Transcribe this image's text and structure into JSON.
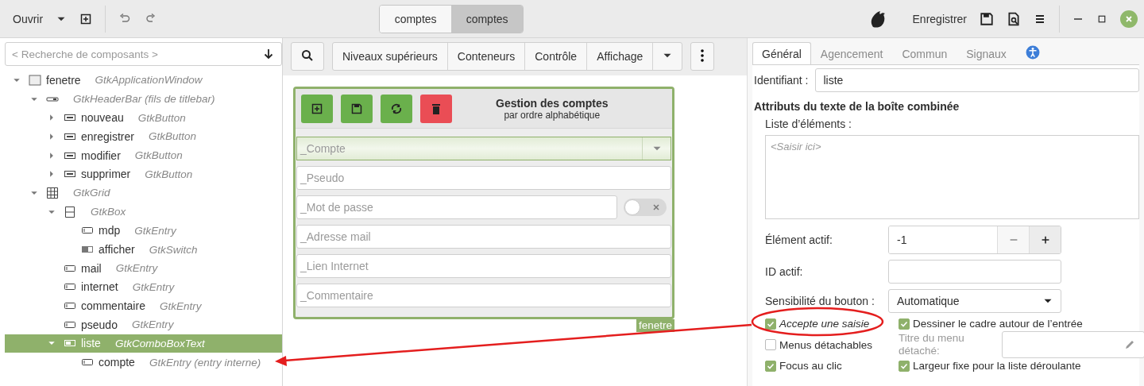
{
  "header": {
    "open_button": "Ouvrir",
    "switcher": [
      {
        "label": "comptes",
        "selected": false
      },
      {
        "label": "comptes",
        "selected": true
      }
    ],
    "save_button": "Enregistrer"
  },
  "search": {
    "placeholder": "< Recherche de composants >"
  },
  "tree": [
    {
      "kind": "window",
      "name": "fenetre",
      "type": "GtkApplicationWindow",
      "expanded": true,
      "selected": false,
      "children": [
        {
          "kind": "headerbar",
          "type": "GtkHeaderBar",
          "note": "(fils de titlebar)",
          "expanded": true,
          "selected": false,
          "children": [
            {
              "kind": "button",
              "name": "nouveau",
              "type": "GtkButton",
              "expanded": false,
              "selected": false
            },
            {
              "kind": "button",
              "name": "enregistrer",
              "type": "GtkButton",
              "expanded": false,
              "selected": false
            },
            {
              "kind": "button",
              "name": "modifier",
              "type": "GtkButton",
              "expanded": false,
              "selected": false
            },
            {
              "kind": "button",
              "name": "supprimer",
              "type": "GtkButton",
              "expanded": false,
              "selected": false
            }
          ]
        },
        {
          "kind": "grid",
          "type": "GtkGrid",
          "expanded": true,
          "selected": false,
          "children": [
            {
              "kind": "box",
              "type": "GtkBox",
              "expanded": true,
              "selected": false,
              "children": [
                {
                  "kind": "entry",
                  "name": "mdp",
                  "type": "GtkEntry",
                  "selected": false
                },
                {
                  "kind": "switch",
                  "name": "afficher",
                  "type": "GtkSwitch",
                  "selected": false
                }
              ]
            },
            {
              "kind": "entry",
              "name": "mail",
              "type": "GtkEntry",
              "selected": false
            },
            {
              "kind": "entry",
              "name": "internet",
              "type": "GtkEntry",
              "selected": false
            },
            {
              "kind": "entry",
              "name": "commentaire",
              "type": "GtkEntry",
              "selected": false
            },
            {
              "kind": "entry",
              "name": "pseudo",
              "type": "GtkEntry",
              "selected": false
            },
            {
              "kind": "combo",
              "name": "liste",
              "type": "GtkComboBoxText",
              "expanded": true,
              "selected": true,
              "children": [
                {
                  "kind": "entry",
                  "name": "compte",
                  "type": "GtkEntry",
                  "note": "(entry interne)",
                  "selected": false
                }
              ]
            }
          ]
        }
      ]
    }
  ],
  "palette": {
    "groups": [
      "Niveaux supérieurs",
      "Conteneurs",
      "Contrôle",
      "Affichage"
    ]
  },
  "preview": {
    "title": "Gestion des comptes",
    "subtitle": "par ordre alphabétique",
    "toolbar": [
      {
        "kind": "new"
      },
      {
        "kind": "save"
      },
      {
        "kind": "refresh"
      },
      {
        "kind": "delete"
      }
    ],
    "combo": {
      "placeholder": "_Compte"
    },
    "entries": [
      {
        "kind": "entry",
        "placeholder": "_Pseudo"
      },
      {
        "kind": "password",
        "placeholder": "_Mot de passe",
        "switch_on": false
      },
      {
        "kind": "entry",
        "placeholder": "_Adresse mail"
      },
      {
        "kind": "entry",
        "placeholder": "_Lien Internet"
      },
      {
        "kind": "entry",
        "placeholder": "_Commentaire"
      }
    ],
    "window_label": "fenetre"
  },
  "inspector": {
    "tabs": [
      {
        "label": "Général",
        "selected": true
      },
      {
        "label": "Agencement",
        "selected": false
      },
      {
        "label": "Commun",
        "selected": false
      },
      {
        "label": "Signaux",
        "selected": false
      }
    ],
    "accessibility_tab": {
      "selected": false
    },
    "id_label": "Identifiant :",
    "id_value": "liste",
    "section": "Attributs du texte de la boîte combinée",
    "items_label": "Liste d’éléments :",
    "items_placeholder": "<Saisir ici>",
    "active_label": "Élément actif:",
    "active_value": "-1",
    "active_id_label": "ID actif:",
    "sensitivity_label": "Sensibilité du bouton :",
    "sensitivity_value": "Automatique",
    "checks": [
      {
        "label": "Accepte une saisie",
        "checked": true,
        "italic": true
      },
      {
        "label": "Dessiner le cadre autour de l’entrée",
        "checked": true,
        "italic": false
      },
      {
        "label": "Menus détachables",
        "checked": false,
        "italic": false
      },
      {
        "label": "Focus au clic",
        "checked": true,
        "italic": false
      },
      {
        "label": "Largeur fixe pour la liste déroulante",
        "checked": true,
        "italic": false
      }
    ],
    "tearoff_label": "Titre du menu détaché:"
  }
}
